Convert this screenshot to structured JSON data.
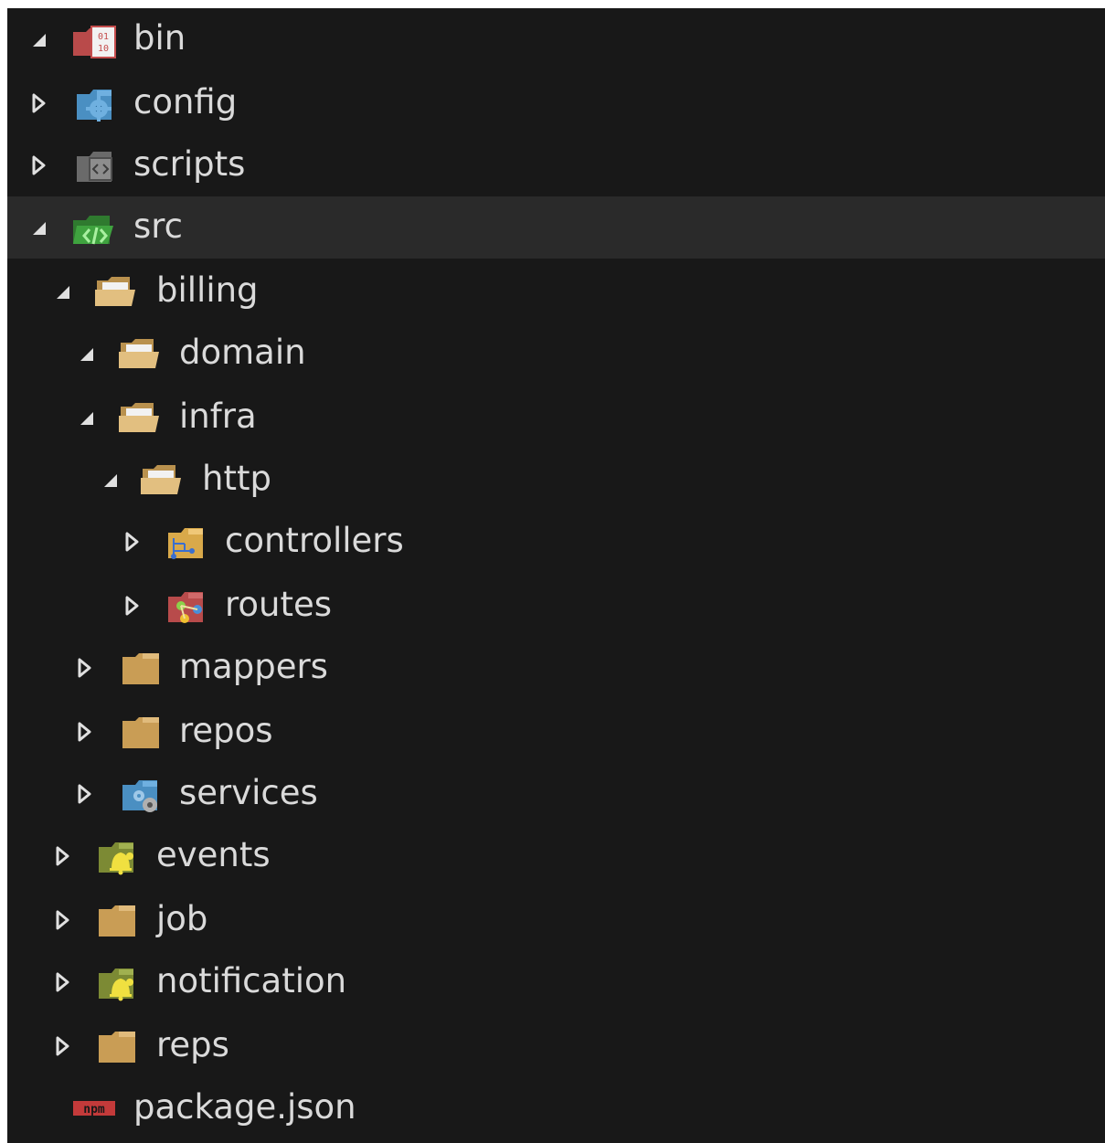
{
  "explorer": {
    "items": [
      {
        "label": "bin",
        "depth": 0,
        "expanded": true,
        "icon": "folder-binary-icon",
        "color": "#c44d4d"
      },
      {
        "label": "config",
        "depth": 0,
        "expanded": false,
        "icon": "folder-config-icon",
        "color": "#4a90c2"
      },
      {
        "label": "scripts",
        "depth": 0,
        "expanded": false,
        "icon": "folder-scripts-icon",
        "color": "#7a7a7a"
      },
      {
        "label": "src",
        "depth": 0,
        "expanded": true,
        "icon": "folder-src-icon",
        "color": "#3f9a3f",
        "selected": true
      },
      {
        "label": "billing",
        "depth": 1,
        "expanded": true,
        "icon": "folder-open-icon",
        "color": "#d9b77a"
      },
      {
        "label": "domain",
        "depth": 2,
        "expanded": true,
        "icon": "folder-open-icon",
        "color": "#d9b77a"
      },
      {
        "label": "infra",
        "depth": 2,
        "expanded": true,
        "icon": "folder-open-icon",
        "color": "#d9b77a"
      },
      {
        "label": "http",
        "depth": 3,
        "expanded": true,
        "icon": "folder-open-icon",
        "color": "#d9b77a"
      },
      {
        "label": "controllers",
        "depth": 4,
        "expanded": false,
        "icon": "folder-controllers-icon",
        "color": "#d9a94a"
      },
      {
        "label": "routes",
        "depth": 4,
        "expanded": false,
        "icon": "folder-routes-icon",
        "color": "#b84b4b"
      },
      {
        "label": "mappers",
        "depth": 2,
        "expanded": false,
        "icon": "folder-icon",
        "color": "#c99d55"
      },
      {
        "label": "repos",
        "depth": 2,
        "expanded": false,
        "icon": "folder-icon",
        "color": "#c99d55"
      },
      {
        "label": "services",
        "depth": 2,
        "expanded": false,
        "icon": "folder-services-icon",
        "color": "#4a8fc2"
      },
      {
        "label": "events",
        "depth": 1,
        "expanded": false,
        "icon": "folder-events-icon",
        "color": "#8a9a3a"
      },
      {
        "label": "job",
        "depth": 1,
        "expanded": false,
        "icon": "folder-icon",
        "color": "#c99d55"
      },
      {
        "label": "notification",
        "depth": 1,
        "expanded": false,
        "icon": "folder-events-icon",
        "color": "#8a9a3a"
      },
      {
        "label": "reps",
        "depth": 1,
        "expanded": false,
        "icon": "folder-icon",
        "color": "#c99d55"
      },
      {
        "label": "package.json",
        "depth": 0,
        "file": true,
        "icon": "npm-icon",
        "color": "#c33a3a"
      }
    ],
    "icon_text": {
      "binary": [
        "01",
        "10"
      ],
      "npm": "npm"
    }
  }
}
